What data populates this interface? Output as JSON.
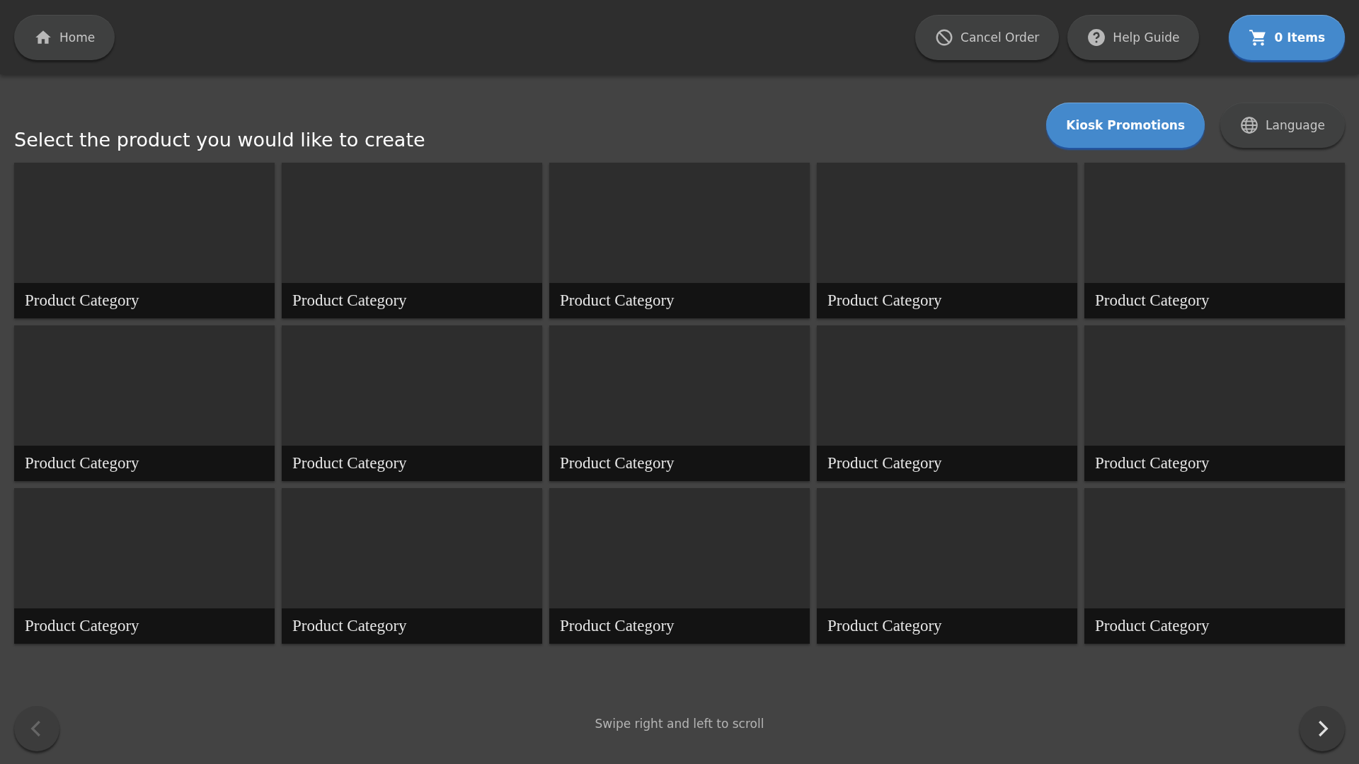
{
  "top_bar": {
    "home_button": {
      "label": "Home"
    },
    "actions": [
      {
        "kind": "cancel",
        "label": "Cancel Order"
      },
      {
        "kind": "help",
        "label": "Help Guide"
      }
    ],
    "cart_button": {
      "label": "0 Items"
    }
  },
  "heading": "Select the product you would like to create",
  "options": [
    {
      "kind": "primary",
      "label": "Kiosk Promotions"
    },
    {
      "kind": "language",
      "label": "Language"
    }
  ],
  "tiles": [
    {
      "label": "Product Category"
    },
    {
      "label": "Product Category"
    },
    {
      "label": "Product Category"
    },
    {
      "label": "Product Category"
    },
    {
      "label": "Product Category"
    },
    {
      "label": "Product Category"
    },
    {
      "label": "Product Category"
    },
    {
      "label": "Product Category"
    },
    {
      "label": "Product Category"
    },
    {
      "label": "Product Category"
    },
    {
      "label": "Product Category"
    },
    {
      "label": "Product Category"
    },
    {
      "label": "Product Category"
    },
    {
      "label": "Product Category"
    },
    {
      "label": "Product Category"
    }
  ],
  "footer": {
    "prev_disabled": true,
    "next_disabled": false,
    "hint": "Swipe right and left to scroll"
  }
}
